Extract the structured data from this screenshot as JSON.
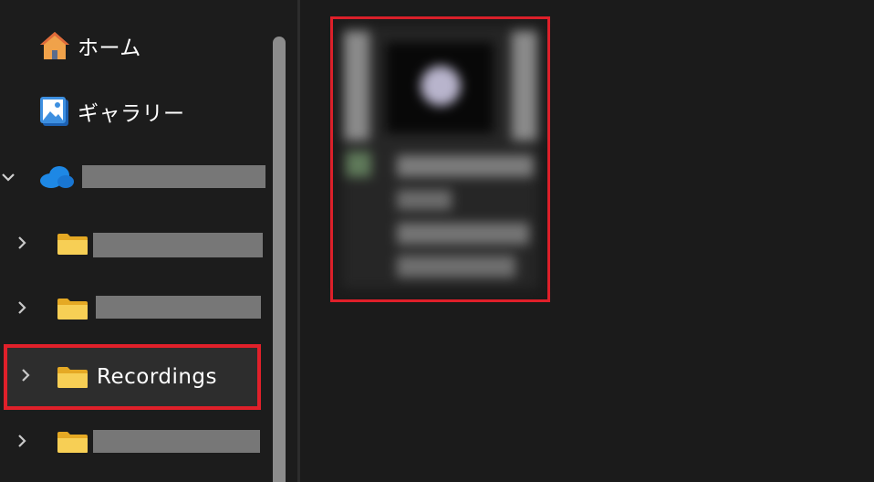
{
  "sidebar": {
    "home_label": "ホーム",
    "gallery_label": "ギャラリー",
    "recordings_label": "Recordings"
  },
  "icons": {
    "home": "home-icon",
    "gallery": "gallery-icon",
    "cloud": "onedrive-cloud-icon",
    "folder": "folder-icon",
    "chevron_right": "chevron-right-icon",
    "chevron_down": "chevron-down-icon"
  },
  "colors": {
    "background": "#1c1c1c",
    "highlight_border": "#e0202a",
    "folder_yellow": "#f5c84c",
    "cloud_blue": "#1e88e5",
    "redaction_gray": "#777777"
  }
}
